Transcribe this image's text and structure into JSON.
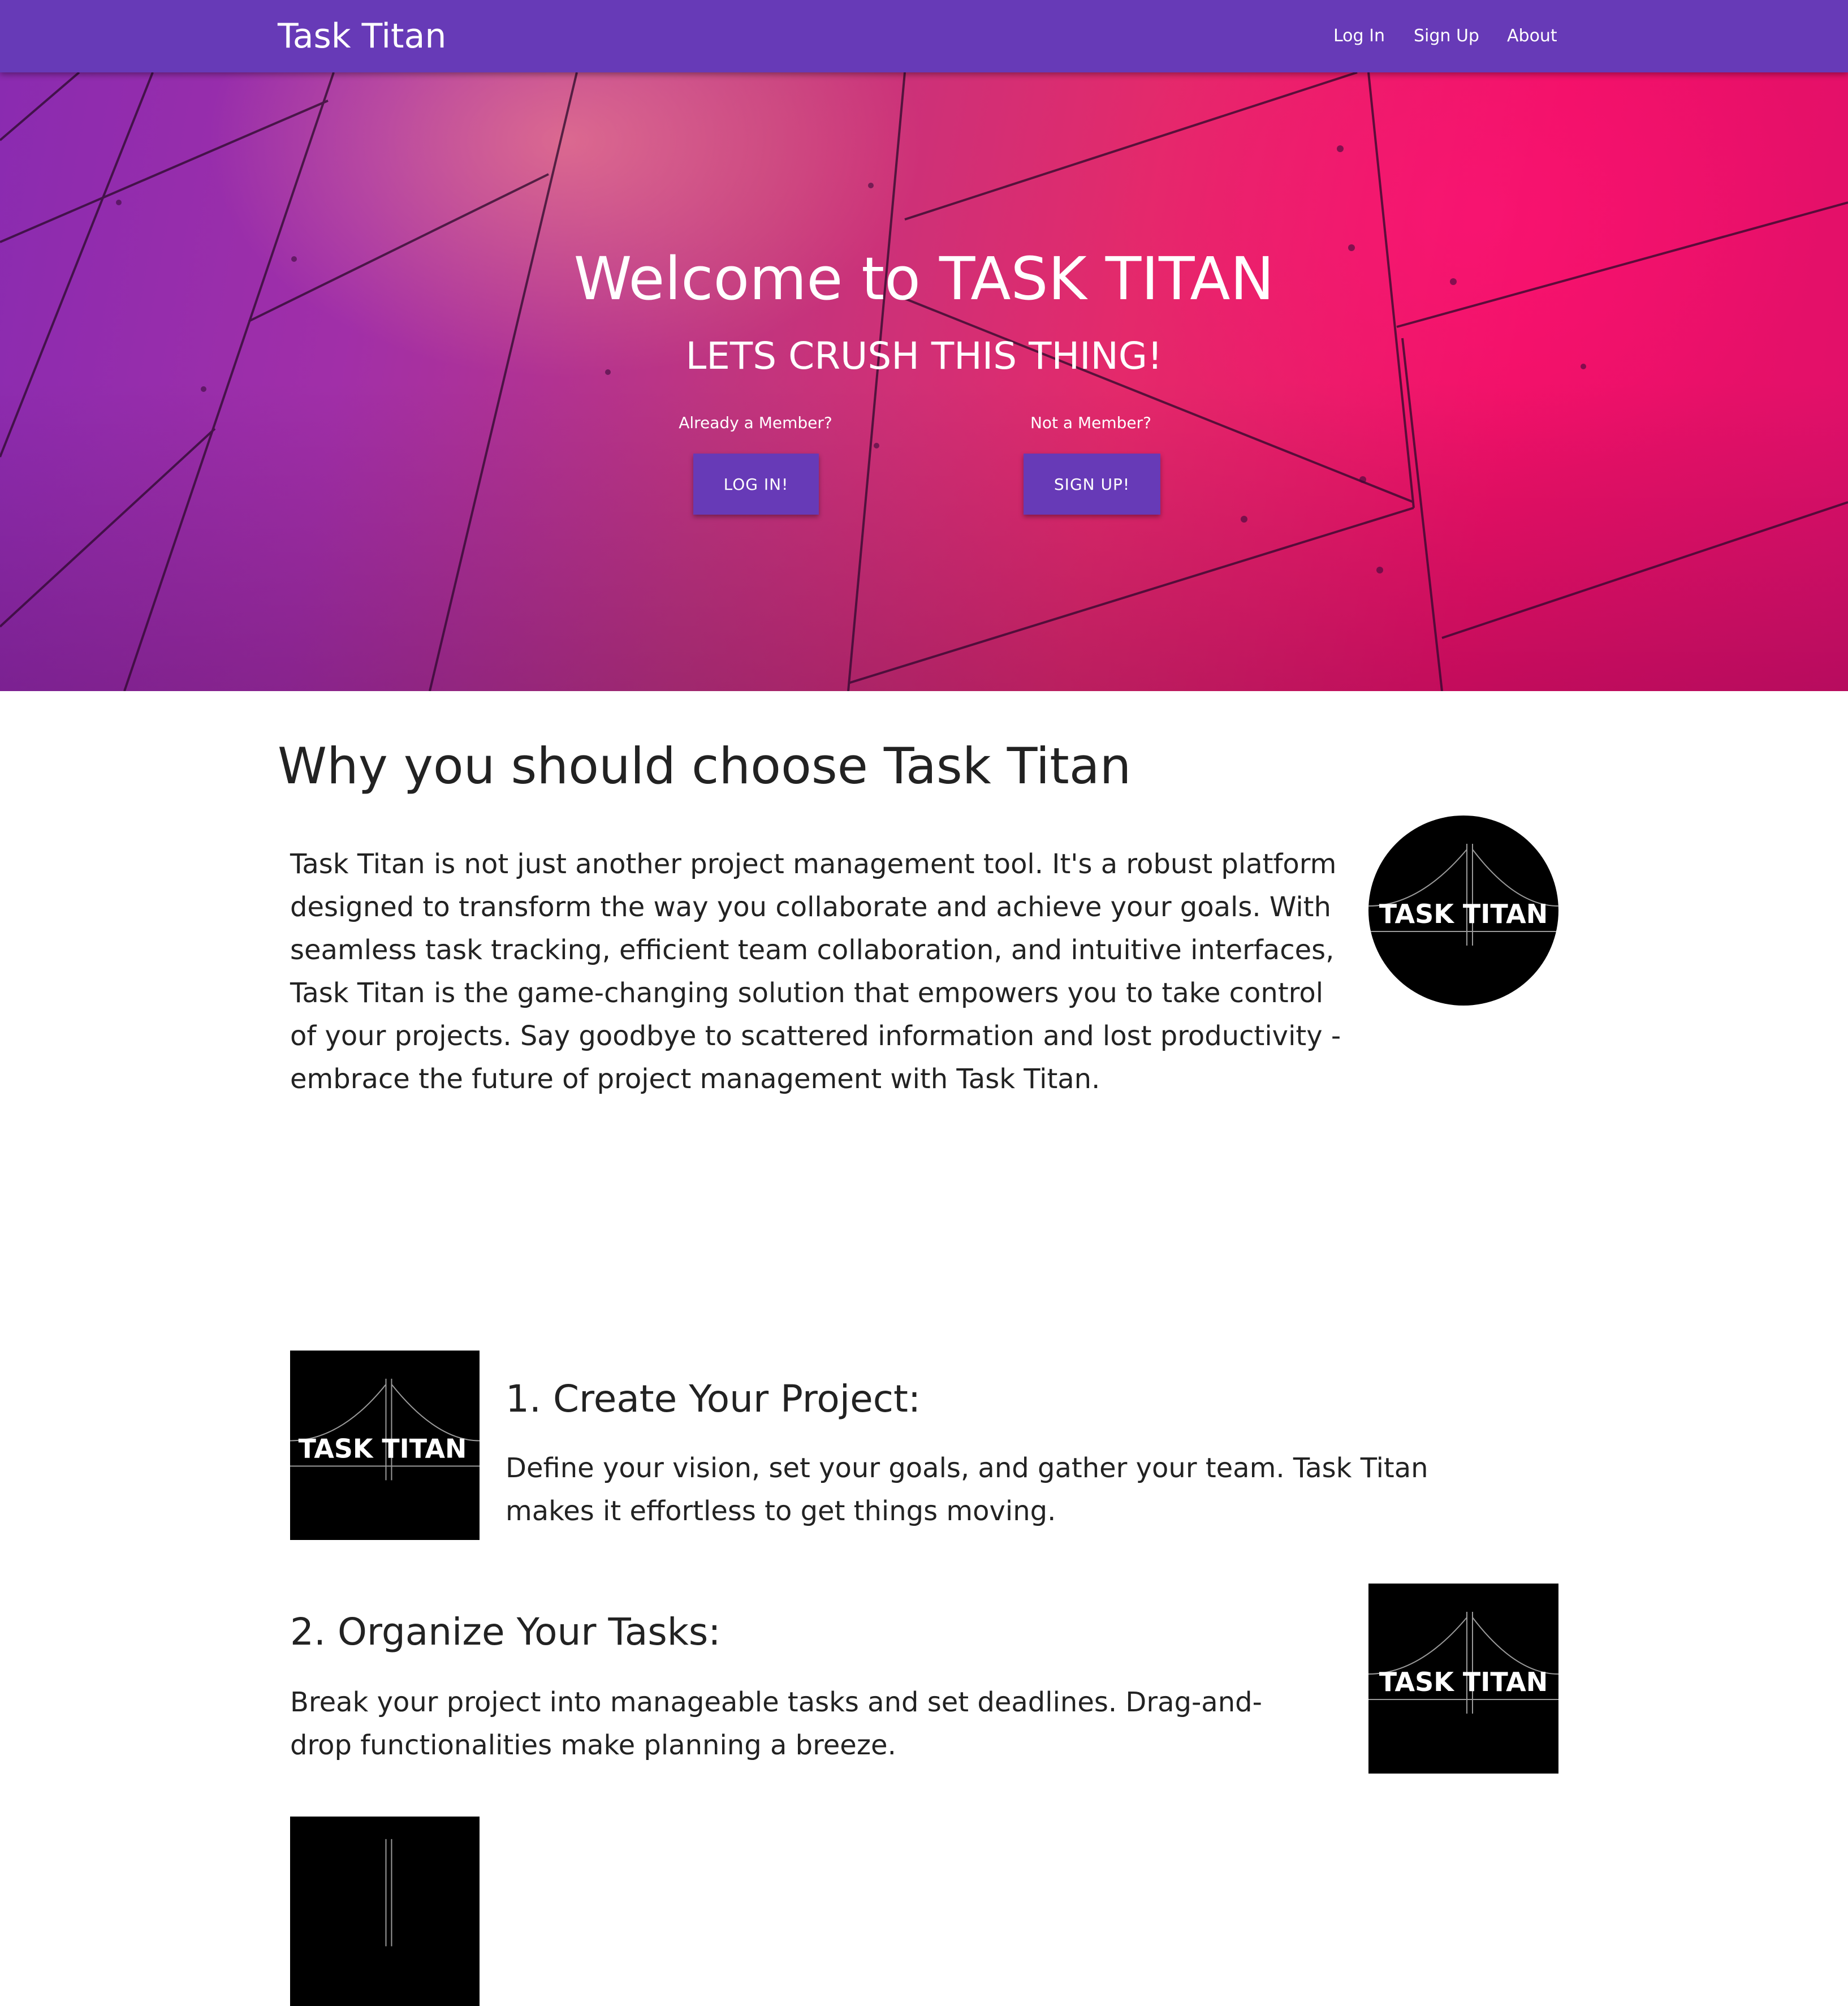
{
  "navbar": {
    "brand": "Task Titan",
    "links": {
      "login": "Log In",
      "signup": "Sign Up",
      "about": "About"
    },
    "color": "#673ab7"
  },
  "hero": {
    "title": "Welcome to TASK TITAN",
    "subtitle": "LETS CRUSH THIS THING!",
    "login_prompt": "Already a Member?",
    "login_button": "LOG IN!",
    "signup_prompt": "Not a Member?",
    "signup_button": "SIGN UP!"
  },
  "why": {
    "title": "Why you should choose Task Titan",
    "text": "Task Titan is not just another project management tool. It's a robust platform designed to transform the way you collaborate and achieve your goals. With seamless task tracking, efficient team collaboration, and intuitive interfaces, Task Titan is the game-changing solution that empowers you to take control of your projects. Say goodbye to scattered information and lost productivity - embrace the future of project management with Task Titan."
  },
  "logo": {
    "text": "TASK TITAN"
  },
  "steps": [
    {
      "title": "1. Create Your Project:",
      "text": "Define your vision, set your goals, and gather your team. Task Titan makes it effortless to get things moving."
    },
    {
      "title": "2. Organize Your Tasks:",
      "text": "Break your project into manageable tasks and set deadlines. Drag-and-drop functionalities make planning a breeze."
    }
  ]
}
